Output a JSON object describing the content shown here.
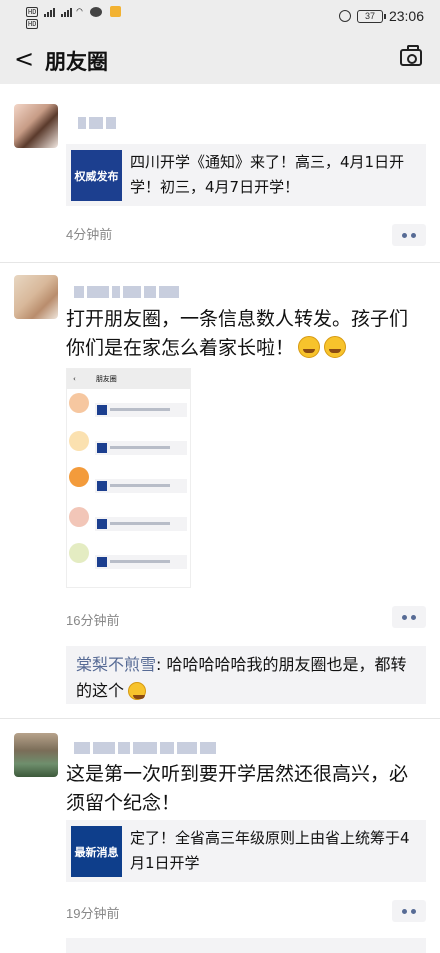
{
  "status_bar": {
    "network_top": "HD 4G",
    "network_bottom": "HD 4G",
    "battery": "37",
    "time": "23:06"
  },
  "nav": {
    "back_glyph": "<",
    "title": "朋友圈",
    "camera_icon": "camera-icon"
  },
  "posts": [
    {
      "link": {
        "thumb_label": "权威发布",
        "title": "四川开学《通知》来了！高三，4月1日开学！初三，4月7日开学！"
      },
      "time": "4分钟前"
    },
    {
      "text": "打开朋友圈，一条信息数人转发。孩子们你们是在家怎么着家长啦！",
      "image": {
        "title": "朋友圈"
      },
      "time": "16分钟前",
      "comment": {
        "author": "棠梨不煎雪",
        "text": ": 哈哈哈哈哈我的朋友圈也是，都转的这个"
      }
    },
    {
      "text": "这是第一次听到要开学居然还很高兴，必须留个纪念！",
      "link": {
        "thumb_label": "最新消息",
        "title": "定了！全省高三年级原则上由省上统筹于4月1日开学"
      },
      "time": "19分钟前"
    }
  ],
  "colors": {
    "link_blue": "#576b95",
    "bar_gray": "#ededed",
    "card_gray": "#f3f3f5"
  }
}
